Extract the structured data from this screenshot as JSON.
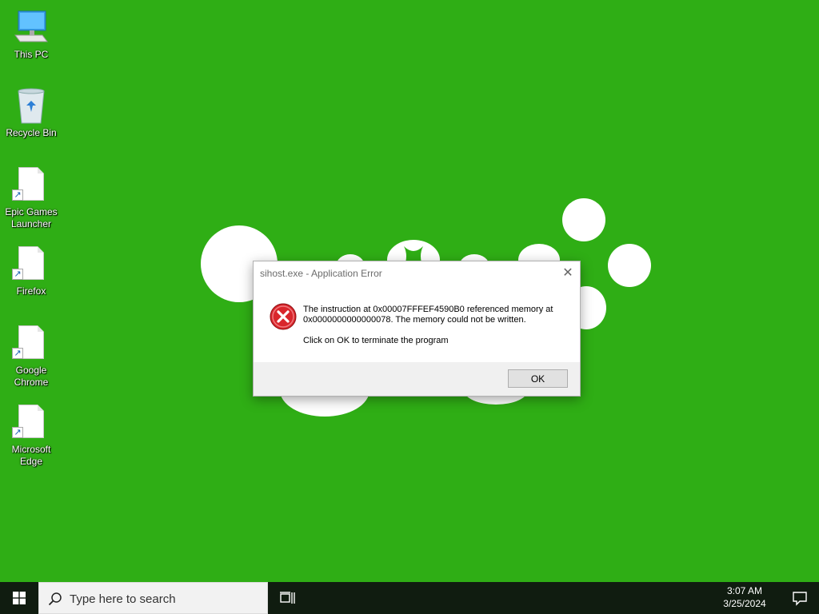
{
  "desktop": {
    "icons": [
      {
        "label": "This PC"
      },
      {
        "label": "Recycle Bin"
      },
      {
        "label": "Epic Games\nLauncher"
      },
      {
        "label": "Firefox"
      },
      {
        "label": "Google\nChrome"
      },
      {
        "label": "Microsoft\nEdge"
      }
    ]
  },
  "dialog": {
    "title": "sihost.exe - Application Error",
    "close_glyph": "✕",
    "icon": "error-icon",
    "message": "The instruction at 0x00007FFFEF4590B0 referenced memory at 0x0000000000000078. The memory could not be written.",
    "prompt": "Click on OK to terminate the program",
    "ok_label": "OK"
  },
  "taskbar": {
    "search_placeholder": "Type here to search",
    "time": "3:07 AM",
    "date": "3/25/2024"
  },
  "colors": {
    "wallpaper": "#2fae15",
    "taskbar": "#101c10",
    "error_red": "#d9262c"
  }
}
